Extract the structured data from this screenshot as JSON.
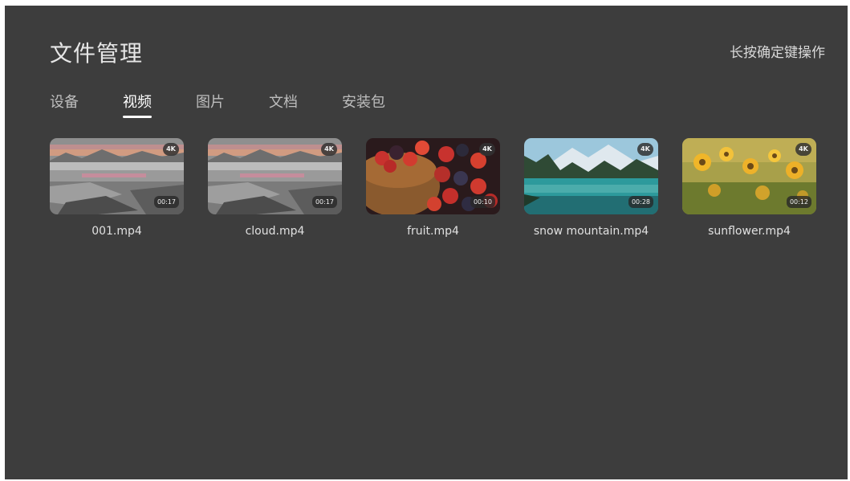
{
  "header": {
    "title": "文件管理",
    "hint": "长按确定键操作"
  },
  "tabs": [
    {
      "label": "设备",
      "active": false
    },
    {
      "label": "视频",
      "active": true
    },
    {
      "label": "图片",
      "active": false
    },
    {
      "label": "文档",
      "active": false
    },
    {
      "label": "安装包",
      "active": false
    }
  ],
  "videos": [
    {
      "name": "001.mp4",
      "resolution": "4K",
      "duration": "00:17",
      "thumbnail": "grayscale-lake-sunset"
    },
    {
      "name": "cloud.mp4",
      "resolution": "4K",
      "duration": "00:17",
      "thumbnail": "grayscale-lake-sunset"
    },
    {
      "name": "fruit.mp4",
      "resolution": "4K",
      "duration": "00:10",
      "thumbnail": "berries-basket"
    },
    {
      "name": "snow mountain.mp4",
      "resolution": "4K",
      "duration": "00:28",
      "thumbnail": "mountain-lake"
    },
    {
      "name": "sunflower.mp4",
      "resolution": "4K",
      "duration": "00:12",
      "thumbnail": "sunflower-field"
    }
  ],
  "colors": {
    "background": "#3d3d3d",
    "text_primary": "#ffffff",
    "text_secondary": "#bdbdbd"
  }
}
